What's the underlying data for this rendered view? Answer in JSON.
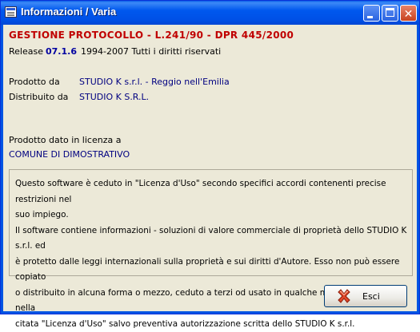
{
  "window": {
    "title": "Informazioni / Varia"
  },
  "header": {
    "product_title": "GESTIONE PROTOCOLLO - L.241/90 - DPR 445/2000",
    "release_label": "Release",
    "release_version": "07.1.6",
    "copyright": "1994-2007 Tutti i diritti riservati"
  },
  "info": {
    "produced_by_label": "Prodotto da",
    "produced_by_value": "STUDIO K s.r.l.  - Reggio nell'Emilia",
    "distributed_by_label": "Distribuito da",
    "distributed_by_value": "STUDIO K S.R.L.",
    "license_label": "Prodotto dato in licenza a",
    "license_value": "COMUNE DI DIMOSTRATIVO"
  },
  "notice": {
    "lines": [
      "Questo software è ceduto in \"Licenza d'Uso\" secondo specifici accordi contenenti precise restrizioni nel",
      "suo impiego.",
      "Il software contiene informazioni - soluzioni  di valore commerciale di proprietà dello STUDIO K s.r.l. ed",
      "è  protetto dalle  leggi internazionali sulla proprietà e sui  diritti d'Autore. Esso non  può essere copiato",
      "o distribuito  in alcuna  forma  o mezzo, ceduto a terzi  od  usato in  qualche  modo non previsto  nella",
      "citata  \"Licenza  d'Uso\"  salvo  preventiva  autorizzazione  scritta  dello  STUDIO K s.r.l."
    ]
  },
  "buttons": {
    "exit_label": "Esci"
  },
  "colors": {
    "title_bar": "#0054e3",
    "heading": "#c00000",
    "value_text": "#000080",
    "dialog_bg": "#ece9d8"
  }
}
